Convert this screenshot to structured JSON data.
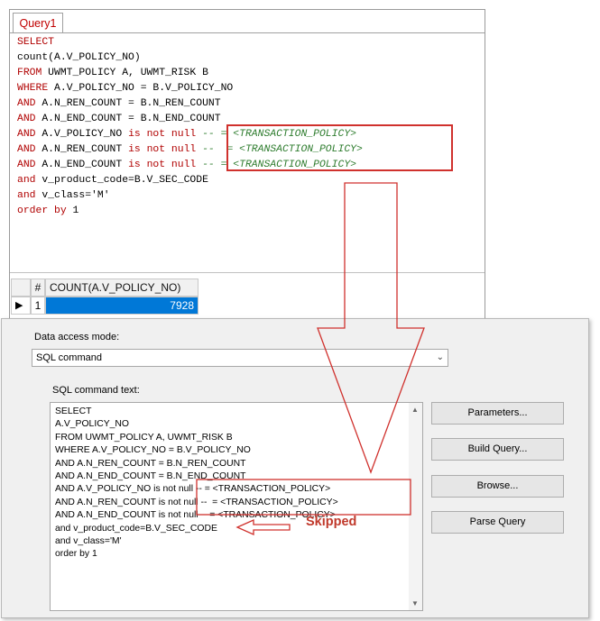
{
  "editor": {
    "tab_label": "Query1",
    "sql_lines": [
      {
        "parts": [
          {
            "t": "SELECT",
            "c": "kw"
          }
        ]
      },
      {
        "parts": [
          {
            "t": "count(A.V_POLICY_NO)",
            "c": ""
          }
        ]
      },
      {
        "parts": [
          {
            "t": "FROM",
            "c": "kw"
          },
          {
            "t": " UWMT_POLICY A, UWMT_RISK B",
            "c": ""
          }
        ]
      },
      {
        "parts": [
          {
            "t": "WHERE",
            "c": "kw"
          },
          {
            "t": " A.V_POLICY_NO = B.V_POLICY_NO",
            "c": ""
          }
        ]
      },
      {
        "parts": [
          {
            "t": "AND",
            "c": "kw"
          },
          {
            "t": " A.N_REN_COUNT = B.N_REN_COUNT",
            "c": ""
          }
        ]
      },
      {
        "parts": [
          {
            "t": "AND",
            "c": "kw"
          },
          {
            "t": " A.N_END_COUNT = B.N_END_COUNT",
            "c": ""
          }
        ]
      },
      {
        "parts": [
          {
            "t": "AND",
            "c": "kw"
          },
          {
            "t": " A.V_POLICY_NO ",
            "c": ""
          },
          {
            "t": "is not null",
            "c": "kw"
          },
          {
            "t": " -- = <TRANSACTION_POLICY>",
            "c": "cm"
          }
        ]
      },
      {
        "parts": [
          {
            "t": "AND",
            "c": "kw"
          },
          {
            "t": " A.N_REN_COUNT ",
            "c": ""
          },
          {
            "t": "is not null",
            "c": "kw"
          },
          {
            "t": " --  = <TRANSACTION_POLICY>",
            "c": "cm"
          }
        ]
      },
      {
        "parts": [
          {
            "t": "AND",
            "c": "kw"
          },
          {
            "t": " A.N_END_COUNT ",
            "c": ""
          },
          {
            "t": "is not null",
            "c": "kw"
          },
          {
            "t": " -- = <TRANSACTION_POLICY>",
            "c": "cm"
          }
        ]
      },
      {
        "parts": [
          {
            "t": "and",
            "c": "kw"
          },
          {
            "t": " v_product_code=B.V_SEC_CODE",
            "c": ""
          }
        ]
      },
      {
        "parts": [
          {
            "t": "and",
            "c": "kw"
          },
          {
            "t": " v_class='M'",
            "c": ""
          }
        ]
      },
      {
        "parts": [
          {
            "t": "order by",
            "c": "kw"
          },
          {
            "t": " 1",
            "c": ""
          }
        ]
      }
    ]
  },
  "results": {
    "header_rownum": "#",
    "header_column": "COUNT(A.V_POLICY_NO)",
    "row_indicator": "▶",
    "row_number": "1",
    "row_value": "7928"
  },
  "dialog": {
    "data_access_label": "Data access mode:",
    "data_access_value": "SQL command",
    "sql_text_label": "SQL command text:",
    "sql_text": "SELECT\nA.V_POLICY_NO\nFROM UWMT_POLICY A, UWMT_RISK B\nWHERE A.V_POLICY_NO = B.V_POLICY_NO\nAND A.N_REN_COUNT = B.N_REN_COUNT\nAND A.N_END_COUNT = B.N_END_COUNT\nAND A.V_POLICY_NO is not null -- = <TRANSACTION_POLICY>\nAND A.N_REN_COUNT is not null --  = <TRANSACTION_POLICY>\nAND A.N_END_COUNT is not null -- = <TRANSACTION_POLICY>\nand v_product_code=B.V_SEC_CODE\nand v_class='M'\norder by 1",
    "buttons": {
      "parameters": "Parameters...",
      "build_query": "Build Query...",
      "browse": "Browse...",
      "parse_query": "Parse Query"
    }
  },
  "annotation": {
    "skipped_label": "Skipped",
    "color": "#d0312d"
  }
}
